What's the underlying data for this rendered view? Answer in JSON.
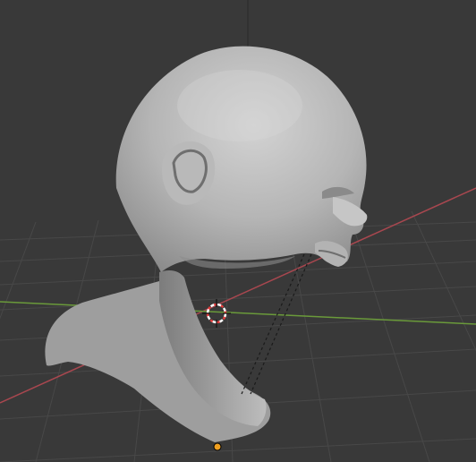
{
  "app": {
    "name": "3D Viewport"
  },
  "viewport": {
    "background": "#393939",
    "grid_line_color": "#4a4a4a",
    "x_axis_color": "#a8474f",
    "y_axis_color": "#6a9a3a",
    "z_axis_color": "#3a3a3a",
    "model": {
      "kind": "sculpted head bust",
      "shade_light": "#c9c9c9",
      "shade_mid": "#a9a9a9",
      "shade_dark": "#6f6f6f"
    },
    "cursor_icon": "3d-cursor-icon",
    "origin_icon": "object-origin-icon",
    "origin_color": "#f0a020",
    "relationship_line": "dashed"
  }
}
